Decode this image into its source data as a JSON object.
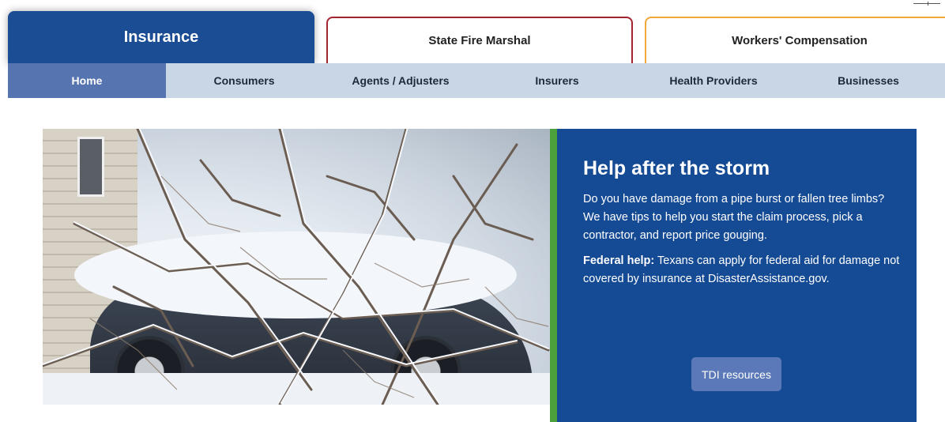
{
  "top_tabs": {
    "insurance": "Insurance",
    "state_fire_marshal": "State Fire Marshal",
    "workers_comp": "Workers' Compensation"
  },
  "subnav": {
    "items": [
      "Home",
      "Consumers",
      "Agents / Adjusters",
      "Insurers",
      "Health Providers",
      "Businesses"
    ],
    "active": "Home"
  },
  "hero": {
    "image_icon": "snow-covered-car-photo",
    "title": "Help after the storm",
    "paragraph1": "Do you have damage from a pipe burst or fallen tree limbs? We have tips to help you start the claim process, pick a contractor, and report price gouging.",
    "federal_label": "Federal help:",
    "federal_text": " Texans can apply for federal aid for damage not covered by insurance at DisasterAssistance.gov.",
    "button_label": "TDI resources"
  },
  "colors": {
    "insurance_tab": "#1a4d94",
    "sfm_border": "#a32530",
    "wc_border": "#f2a73b",
    "subnav_bg": "#c8d6e6",
    "subnav_active": "#5574b0",
    "panel_bg": "#154a95",
    "accent_bar": "#4da13d",
    "button_bg": "#5b79b8"
  }
}
